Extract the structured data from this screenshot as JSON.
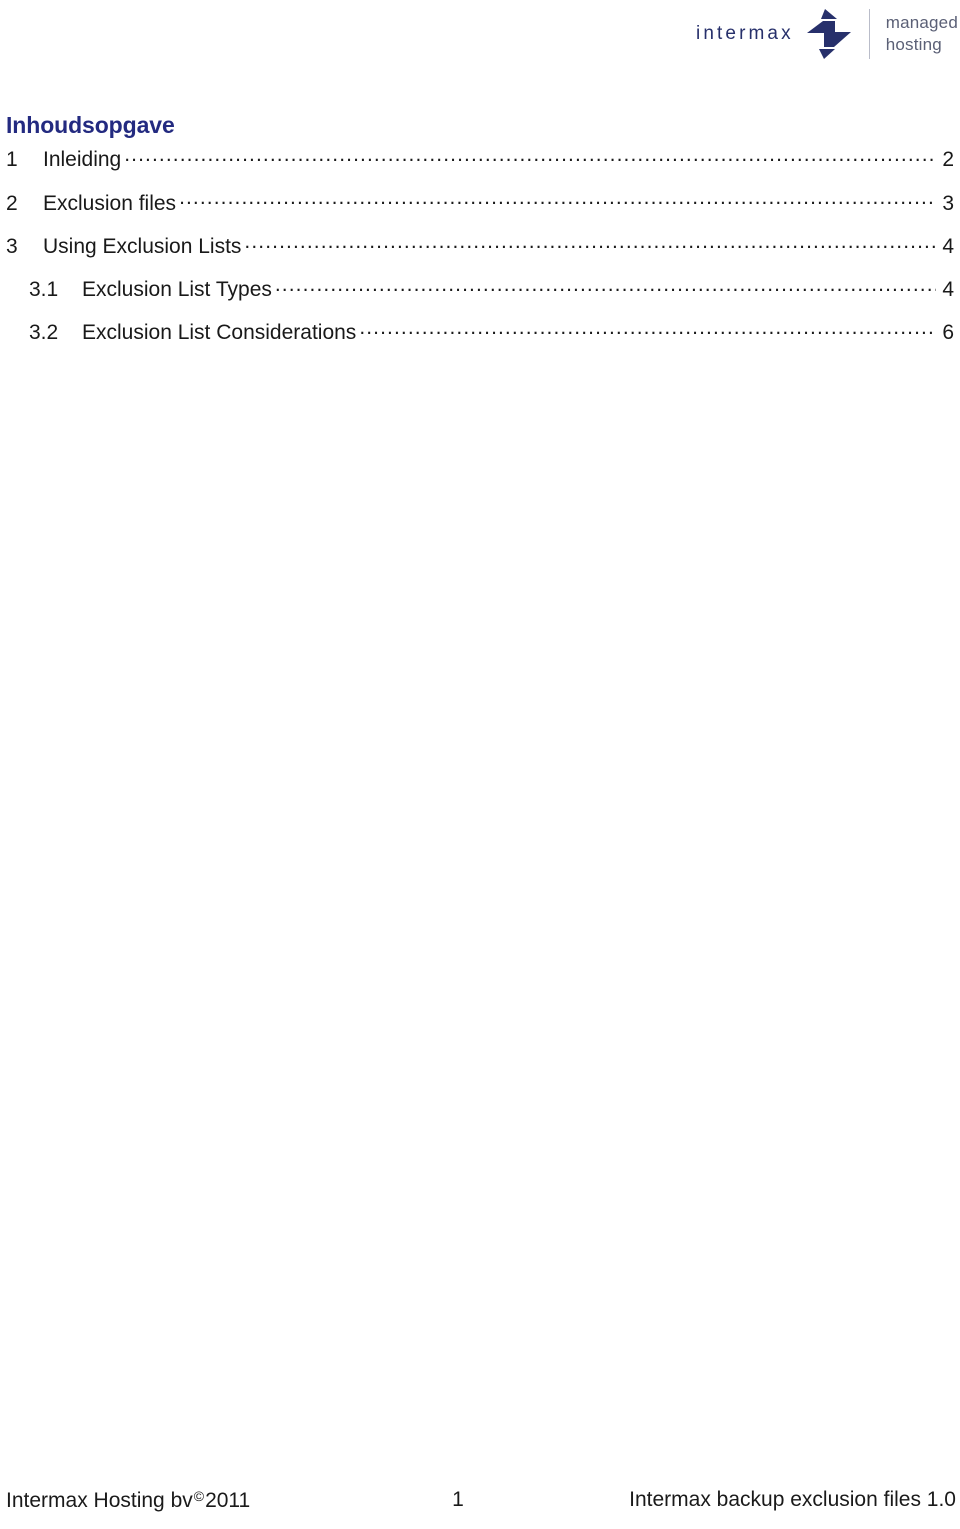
{
  "header": {
    "logo": {
      "wordmark": "intermax",
      "mark_name": "intermax-arrows-logo-mark",
      "tagline_line1": "managed",
      "tagline_line2": "hosting",
      "brand_color": "#27306b",
      "tagline_color": "#5b6076"
    }
  },
  "toc": {
    "title": "Inhoudsopgave",
    "title_color": "#232a80",
    "entries": [
      {
        "number": "1",
        "label": "Inleiding",
        "page": "2",
        "level": 1
      },
      {
        "number": "2",
        "label": "Exclusion files",
        "page": "3",
        "level": 1
      },
      {
        "number": "3",
        "label": "Using Exclusion Lists",
        "page": "4",
        "level": 1
      },
      {
        "number": "3.1",
        "label": "Exclusion List Types",
        "page": "4",
        "level": 2
      },
      {
        "number": "3.2",
        "label": "Exclusion List Considerations",
        "page": "6",
        "level": 2
      }
    ]
  },
  "footer": {
    "left_text": "Intermax Hosting bv",
    "copyright_symbol": "©",
    "year": "2011",
    "page_number": "1",
    "right_text": "Intermax backup exclusion files 1.0"
  }
}
